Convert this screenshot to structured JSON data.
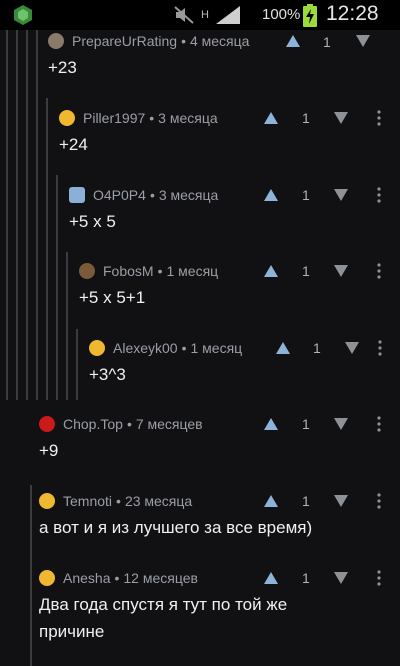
{
  "status_bar": {
    "battery_percent": "100%",
    "time": "12:28",
    "network_label": "H",
    "icons": [
      "app-icon",
      "mute-icon",
      "data-arrows-icon",
      "signal-icon",
      "battery-charging-icon"
    ]
  },
  "comments": [
    {
      "author": "PrepareUrRating",
      "age": "4 месяца",
      "score": "1",
      "text": "+23",
      "avatar_color": "#8a7a6a"
    },
    {
      "author": "Piller1997",
      "age": "3 месяца",
      "score": "1",
      "text": "+24",
      "avatar_color": "#f0b830"
    },
    {
      "author": "O4P0P4",
      "age": "3 месяца",
      "score": "1",
      "text": "+5 x 5",
      "avatar_color": "#8ab0d8"
    },
    {
      "author": "FobosM",
      "age": "1 месяц",
      "score": "1",
      "text": "+5 x 5+1",
      "avatar_color": "#7a5a3a"
    },
    {
      "author": "Alexeyk00",
      "age": "1 месяц",
      "score": "1",
      "text": "+3^3",
      "avatar_color": "#f0b830"
    },
    {
      "author": "Chop.Top",
      "age": "7 месяцев",
      "score": "1",
      "text": "+9",
      "avatar_color": "#cc1a1a"
    },
    {
      "author": "Temnoti",
      "age": "23 месяца",
      "score": "1",
      "text": "а вот и я из лучшего за все время)",
      "avatar_color": "#f0b830"
    },
    {
      "author": "Anesha",
      "age": "12 месяцев",
      "score": "1",
      "text_lines": [
        "Два года спустя я тут по той же",
        "причине"
      ],
      "avatar_color": "#f0b830"
    }
  ],
  "colors": {
    "background": "#111113",
    "thread_line": "#3c3c40",
    "vote_arrow": "#8db4d8",
    "meta_text": "#9a9ea6"
  }
}
